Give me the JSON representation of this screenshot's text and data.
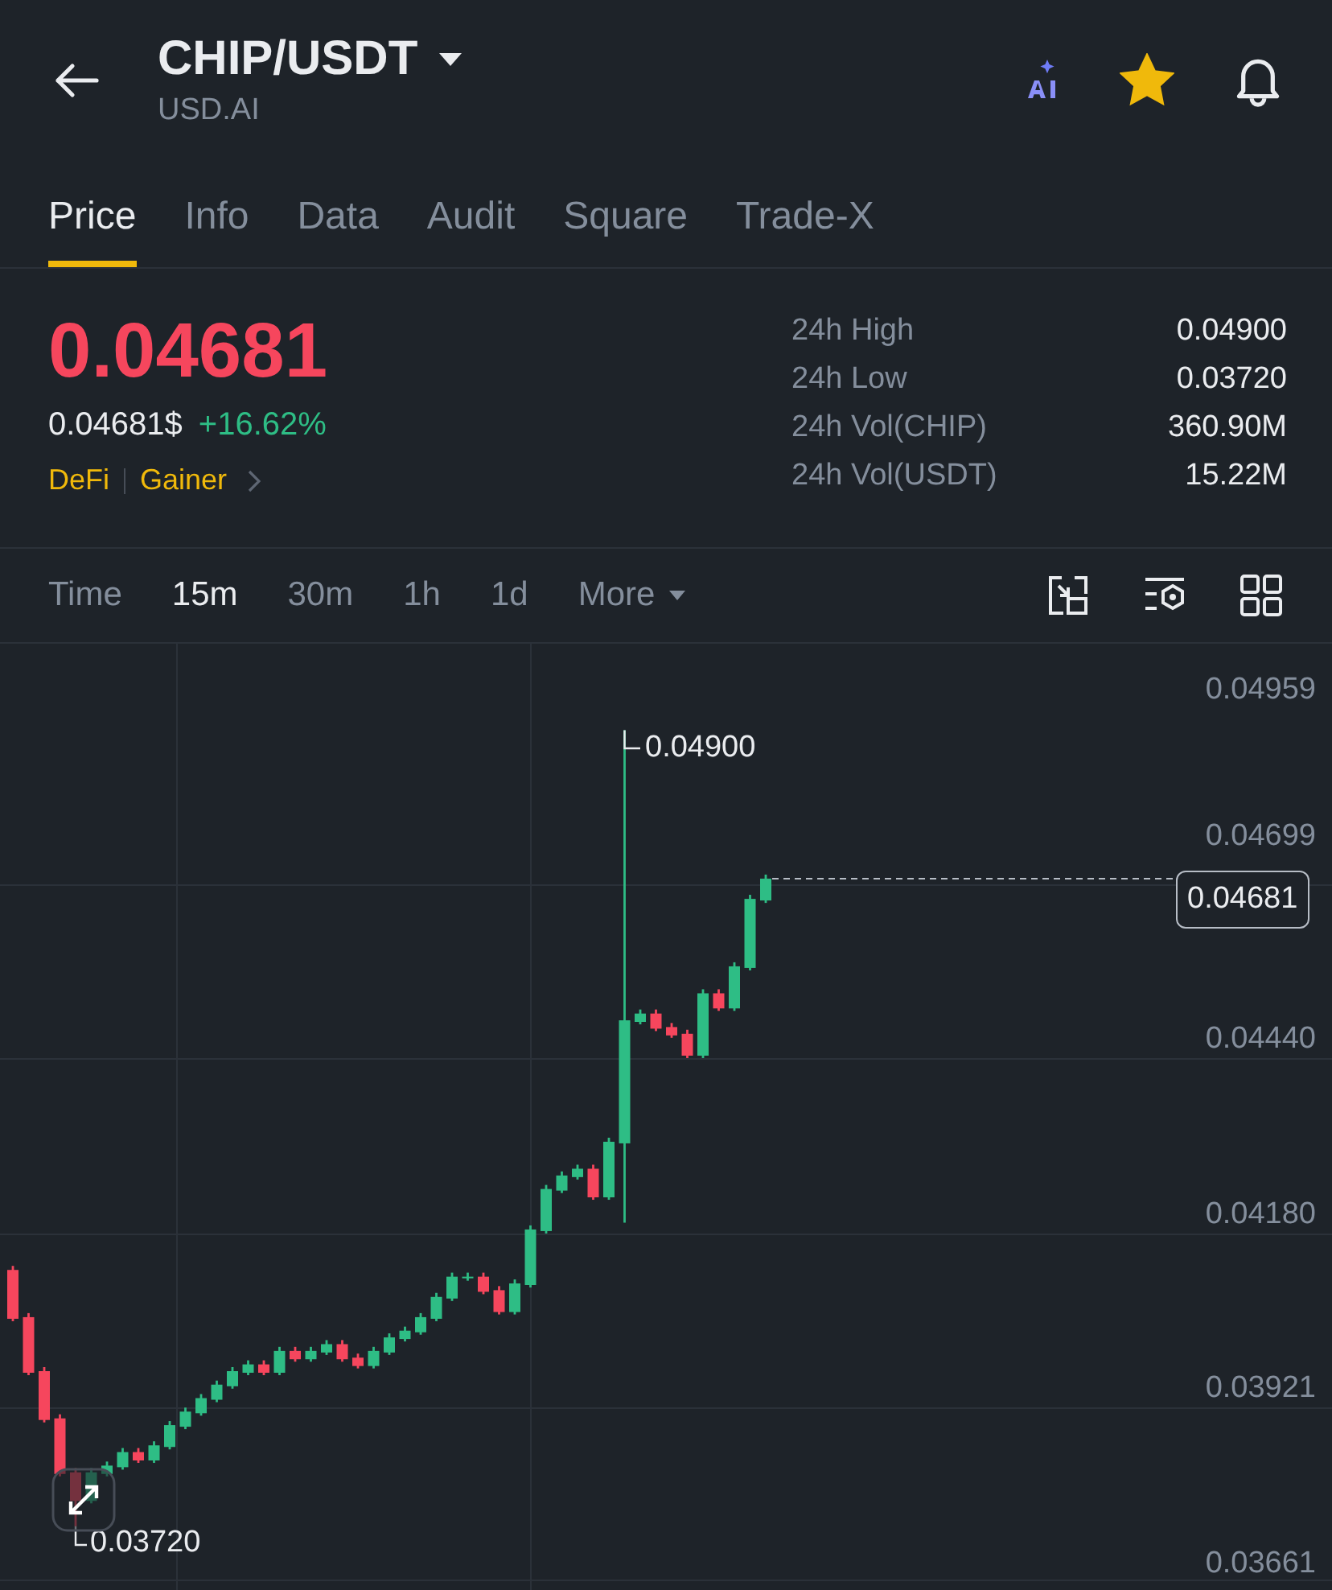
{
  "header": {
    "title": "CHIP/USDT",
    "subtitle": "USD.AI",
    "favorited": true
  },
  "tabs": [
    {
      "label": "Price",
      "selected": true
    },
    {
      "label": "Info",
      "selected": false
    },
    {
      "label": "Data",
      "selected": false
    },
    {
      "label": "Audit",
      "selected": false
    },
    {
      "label": "Square",
      "selected": false
    },
    {
      "label": "Trade-X",
      "selected": false
    }
  ],
  "ticker": {
    "last_price": "0.04681",
    "usd_price": "0.04681$",
    "change": "+16.62%",
    "tags": [
      "DeFi",
      "Gainer"
    ]
  },
  "stats": [
    {
      "label": "24h High",
      "value": "0.04900"
    },
    {
      "label": "24h Low",
      "value": "0.03720"
    },
    {
      "label": "24h Vol(CHIP)",
      "value": "360.90M"
    },
    {
      "label": "24h Vol(USDT)",
      "value": "15.22M"
    }
  ],
  "intervals": [
    {
      "label": "Time",
      "kind": "label",
      "selected": false
    },
    {
      "label": "15m",
      "kind": "option",
      "selected": true
    },
    {
      "label": "30m",
      "kind": "option",
      "selected": false
    },
    {
      "label": "1h",
      "kind": "option",
      "selected": false
    },
    {
      "label": "1d",
      "kind": "option",
      "selected": false
    },
    {
      "label": "More",
      "kind": "dropdown",
      "selected": false
    }
  ],
  "chart": {
    "y_labels": [
      "0.04959",
      "0.04699",
      "0.04440",
      "0.04180",
      "0.03921",
      "0.03661"
    ],
    "high_label": "0.04900",
    "low_label": "0.03720",
    "current_price": "0.04681"
  }
}
